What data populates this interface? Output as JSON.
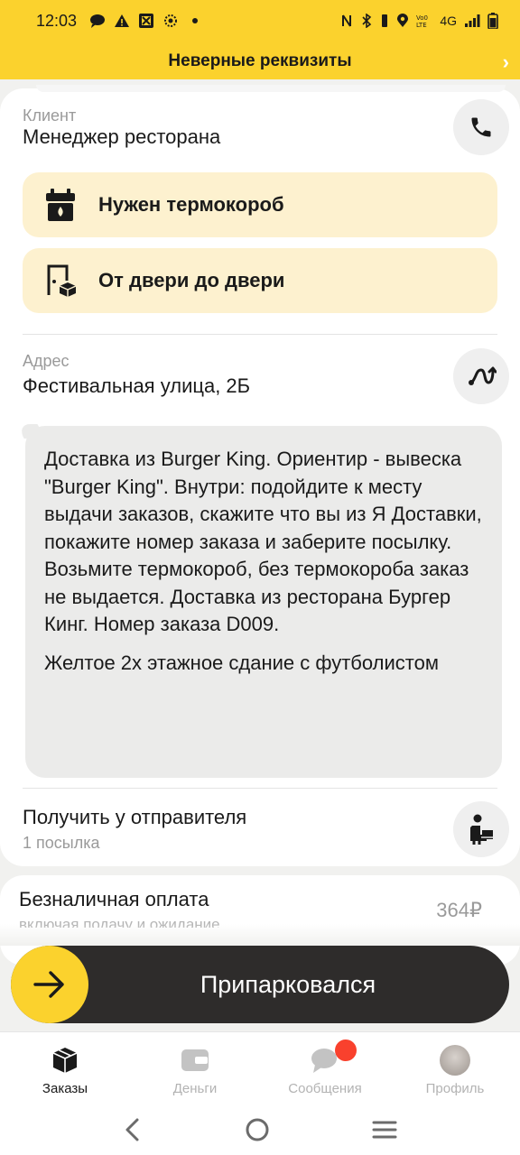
{
  "status_bar": {
    "time": "12:03",
    "network": "4G"
  },
  "banner": {
    "text": "Неверные реквизиты"
  },
  "client": {
    "label": "Клиент",
    "value": "Менеджер ресторана"
  },
  "features": [
    {
      "text": "Нужен термокороб",
      "icon": "thermo-box-icon"
    },
    {
      "text": "От двери до двери",
      "icon": "door-to-door-icon"
    }
  ],
  "address": {
    "label": "Адрес",
    "value": "Фестивальная улица, 2Б"
  },
  "comment": {
    "paragraph1": "Доставка из Burger King. Ориентир - вывеска \"Burger King\". Внутри: подойдите к месту выдачи заказов, скажите что вы из Я Доставки, покажите номер заказа и заберите посылку. Возьмите термокороб, без термокороба заказ не выдается. Доставка из ресторана Бургер Кинг. Номер заказа D009.",
    "paragraph2": "Желтое 2х этажное сдание с футболистом"
  },
  "pickup": {
    "title": "Получить у отправителя",
    "subtitle": "1 посылка"
  },
  "payment": {
    "title": "Безналичная оплата",
    "subtitle": "включая подачу и ожидание",
    "amount": "364₽"
  },
  "action": {
    "label": "Припарковался"
  },
  "tabs": [
    {
      "label": "Заказы",
      "active": true
    },
    {
      "label": "Деньги",
      "active": false
    },
    {
      "label": "Сообщения",
      "active": false
    },
    {
      "label": "Профиль",
      "active": false
    }
  ],
  "colors": {
    "accent_yellow": "#fbd22d",
    "feature_bg": "#fdf1cf",
    "slider_bg": "#2e2c2b",
    "badge_red": "#f9412d"
  }
}
